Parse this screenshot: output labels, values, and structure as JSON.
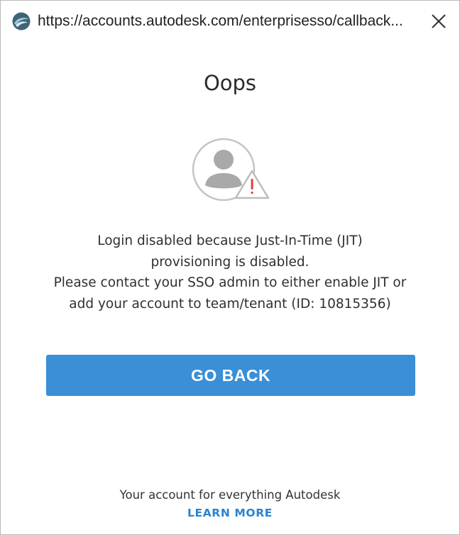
{
  "window": {
    "url": "https://accounts.autodesk.com/enterprisesso/callback..."
  },
  "icons": {
    "app": "autodesk-logo-icon",
    "close": "close-icon",
    "avatar": "user-avatar-icon",
    "warning": "warning-triangle-icon"
  },
  "main": {
    "heading": "Oops",
    "message_lines": [
      "Login disabled because Just-In-Time (JIT)",
      "provisioning is disabled.",
      "Please contact your SSO admin to either enable JIT or",
      "add your account to team/tenant (ID: 10815356)"
    ],
    "button_label": "GO BACK"
  },
  "footer": {
    "text": "Your account for everything Autodesk",
    "link": "LEARN MORE"
  },
  "colors": {
    "button": "#3a8fd7",
    "link": "#2a83d1",
    "warning": "#e0413a"
  }
}
